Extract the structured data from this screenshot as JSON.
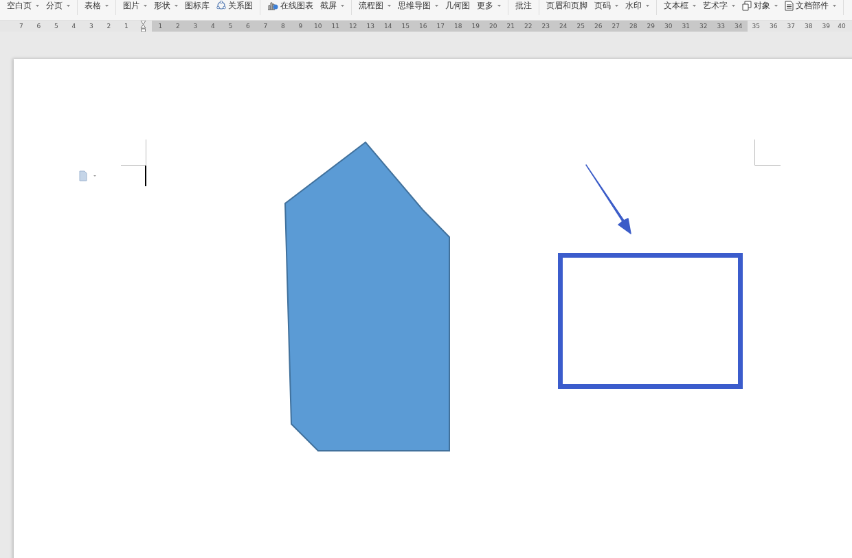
{
  "toolbar": {
    "groups": [
      {
        "items": [
          {
            "label": "空白页",
            "dropdown": true,
            "kind": "text"
          },
          {
            "label": "分页",
            "dropdown": true,
            "kind": "text"
          }
        ]
      },
      {
        "items": [
          {
            "label": "表格",
            "dropdown": true,
            "kind": "text"
          }
        ]
      },
      {
        "items": [
          {
            "label": "图片",
            "dropdown": true,
            "kind": "text"
          },
          {
            "label": "形状",
            "dropdown": true,
            "kind": "text"
          },
          {
            "label": "图标库",
            "dropdown": false,
            "kind": "text"
          },
          {
            "label": "关系图",
            "dropdown": false,
            "kind": "relation"
          }
        ]
      },
      {
        "items": [
          {
            "label": "在线图表",
            "dropdown": false,
            "kind": "chart"
          },
          {
            "label": "截屏",
            "dropdown": true,
            "kind": "text"
          }
        ]
      },
      {
        "items": [
          {
            "label": "流程图",
            "dropdown": true,
            "kind": "text"
          },
          {
            "label": "思维导图",
            "dropdown": true,
            "kind": "text"
          },
          {
            "label": "几何图",
            "dropdown": false,
            "kind": "text"
          },
          {
            "label": "更多",
            "dropdown": true,
            "kind": "text"
          }
        ]
      },
      {
        "items": [
          {
            "label": "批注",
            "dropdown": false,
            "kind": "text"
          }
        ]
      },
      {
        "items": [
          {
            "label": "页眉和页脚",
            "dropdown": false,
            "kind": "text"
          },
          {
            "label": "页码",
            "dropdown": true,
            "kind": "text"
          },
          {
            "label": "水印",
            "dropdown": true,
            "kind": "text"
          }
        ]
      },
      {
        "items": [
          {
            "label": "文本框",
            "dropdown": true,
            "kind": "text"
          },
          {
            "label": "艺术字",
            "dropdown": true,
            "kind": "text"
          },
          {
            "label": "对象",
            "dropdown": true,
            "kind": "object"
          },
          {
            "label": "文档部件",
            "dropdown": true,
            "kind": "document"
          }
        ]
      }
    ]
  },
  "ruler": {
    "left_numbers": [
      "7",
      "6",
      "5",
      "4",
      "3",
      "2",
      "1"
    ],
    "right_numbers": [
      "1",
      "2",
      "3",
      "4",
      "5",
      "6",
      "7",
      "8",
      "9",
      "10",
      "11",
      "12",
      "13",
      "14",
      "15",
      "16",
      "17",
      "18",
      "19",
      "20",
      "21",
      "22",
      "23",
      "24",
      "25",
      "26",
      "27",
      "28",
      "29",
      "30",
      "31",
      "32",
      "33",
      "34",
      "35",
      "36",
      "37",
      "38",
      "39",
      "40"
    ]
  }
}
